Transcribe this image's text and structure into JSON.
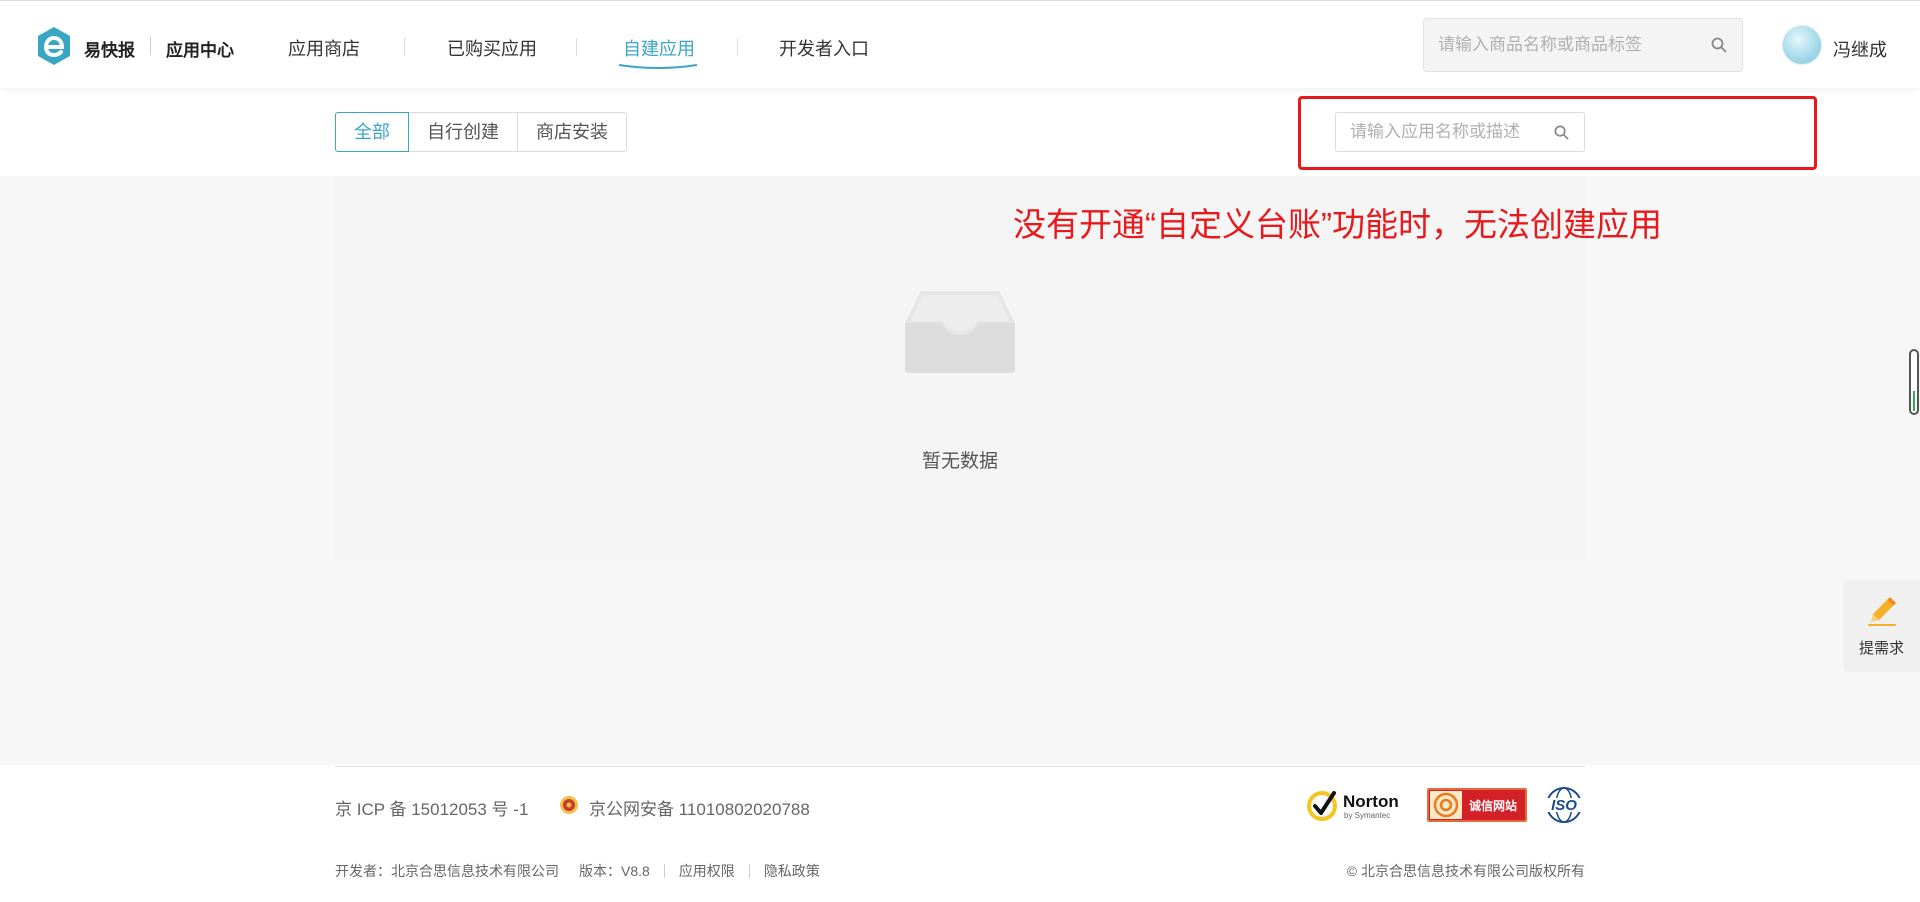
{
  "header": {
    "brand": "易快报",
    "brand_sub": "应用中心",
    "nav": [
      {
        "label": "应用商店"
      },
      {
        "label": "已购买应用"
      },
      {
        "label": "自建应用",
        "active": true
      },
      {
        "label": "开发者入口"
      }
    ],
    "search_placeholder": "请输入商品名称或商品标签",
    "user_name": "冯继成",
    "accent_color": "#3aa6c6"
  },
  "toolbar": {
    "tabs": [
      {
        "label": "全部",
        "active": true
      },
      {
        "label": "自行创建"
      },
      {
        "label": "商店安装"
      }
    ],
    "search_placeholder": "请输入应用名称或描述"
  },
  "annotation": {
    "text": "没有开通“自定义台账”功能时，无法创建应用",
    "color": "#e8191c"
  },
  "main": {
    "empty_text": "暂无数据",
    "empty_icon": "empty-inbox-icon"
  },
  "float": {
    "label": "提需求",
    "icon": "pencil-icon"
  },
  "footer": {
    "icp": "京 ICP 备 15012053 号 -1",
    "police": "京公网安备 11010802020788",
    "developer": "开发者：北京合思信息技术有限公司",
    "version": "版本：V8.8",
    "permissions": "应用权限",
    "privacy": "隐私政策",
    "copyright": "© 北京合思信息技术有限公司版权所有",
    "badges": {
      "norton": "Norton",
      "norton_sub": "by Symantec",
      "cxwz": "诚信网站",
      "iso": "ISO"
    }
  }
}
